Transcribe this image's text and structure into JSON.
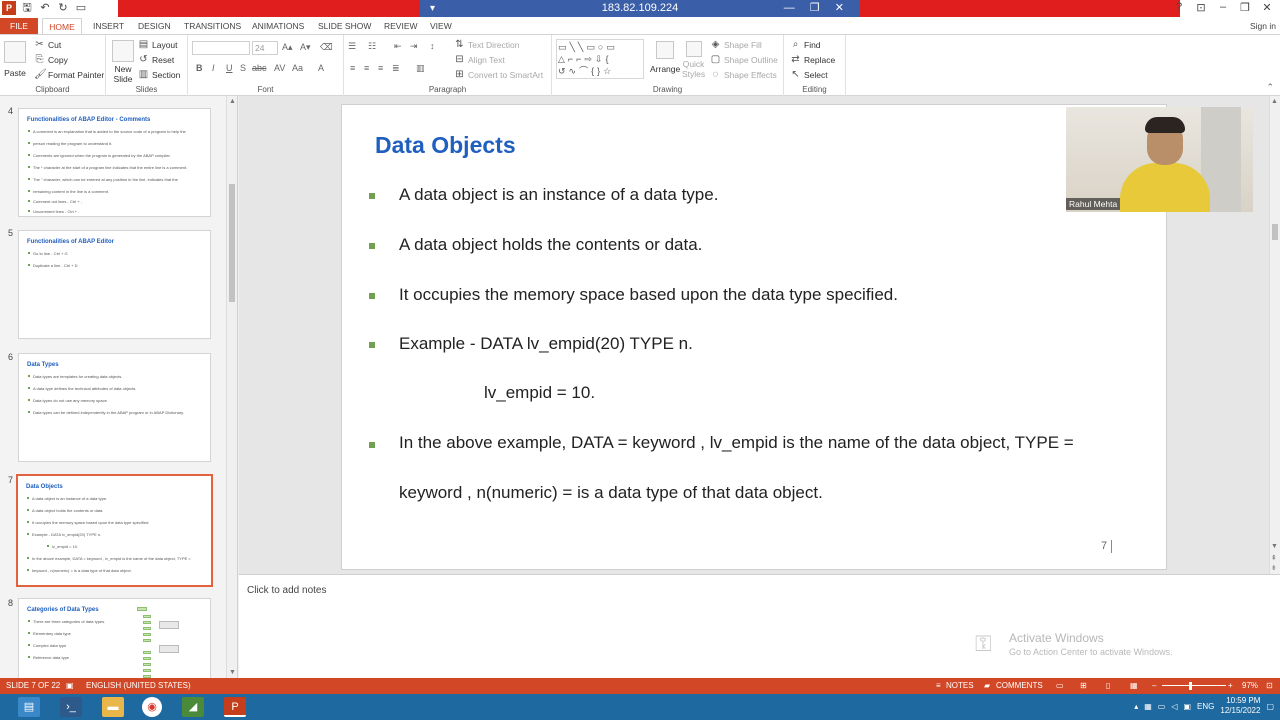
{
  "titlebar": {
    "remote_ip": "183.82.109.224",
    "remote_left": "▾",
    "remote_controls": "— ❐ ✕"
  },
  "ribbon_tabs": [
    "FILE",
    "HOME",
    "INSERT",
    "DESIGN",
    "TRANSITIONS",
    "ANIMATIONS",
    "SLIDE SHOW",
    "REVIEW",
    "VIEW"
  ],
  "signin": "Sign in",
  "ribbon": {
    "clipboard": {
      "paste": "Paste",
      "cut": "Cut",
      "copy": "Copy",
      "format_painter": "Format Painter",
      "label": "Clipboard"
    },
    "slides": {
      "new_slide": "New",
      "new_slide2": "Slide",
      "layout": "Layout",
      "reset": "Reset",
      "section": "Section",
      "label": "Slides"
    },
    "font": {
      "size": "24",
      "label": "Font"
    },
    "paragraph": {
      "text_direction": "Text Direction",
      "align_text": "Align Text",
      "convert": "Convert to SmartArt",
      "label": "Paragraph"
    },
    "drawing": {
      "arrange": "Arrange",
      "quick_styles": "Quick",
      "quick_styles2": "Styles",
      "shape_fill": "Shape Fill",
      "shape_outline": "Shape Outline",
      "shape_effects": "Shape Effects",
      "label": "Drawing"
    },
    "editing": {
      "find": "Find",
      "replace": "Replace",
      "select": "Select",
      "label": "Editing"
    }
  },
  "thumbnails": [
    {
      "num": "4",
      "title": "Functionalities of ABAP Editor - Comments",
      "lines": [
        "A comment is an explanation that is added to the source code of a program to help the",
        "person reading the program to understand it.",
        "Comments are ignored when the program is generated by the ABAP compiler.",
        "The * character at the start of a program line indicates that the entire line is a comment.",
        "The \" character, which can be entered at any position in the line, indicates that the",
        "remaining content in the line is a comment.",
        "Comment out lines -  Ctrl + ,",
        "Uncomment lines -  Ctrl + ."
      ]
    },
    {
      "num": "5",
      "title": "Functionalities of ABAP Editor",
      "lines": [
        "Go to line - Ctrl + G",
        "Duplicate a line - Ctrl + D"
      ]
    },
    {
      "num": "6",
      "title": "Data Types",
      "lines": [
        "Data types are templates for creating data objects.",
        "A data type defines the technical attributes of data objects.",
        "Data types do not use any memory space.",
        "Data types can be defined independently in the ABAP program or in ABAP Dictionary."
      ]
    },
    {
      "num": "7",
      "title": "Data Objects",
      "lines": [
        "A data object is an instance of a data type.",
        "A data object holds the contents or data.",
        "It occupies the memory space based upon the data type specified.",
        "Example - DATA lv_empid(20) TYPE n.",
        "lv_empid = 10.",
        "In the above example, DATA = keyword , lv_empid is the name of the data object, TYPE =",
        "keyword , n(numeric) =  is a data type of that data object."
      ]
    },
    {
      "num": "8",
      "title": "Categories of Data Types",
      "lines": [
        "There are three categories of data types.",
        "Elementary data type",
        "Complex data type",
        "Reference data type"
      ]
    }
  ],
  "slide": {
    "title": "Data Objects",
    "bullets": [
      "A data object is an instance of a data type.",
      "A data object holds the contents or data.",
      "It occupies the memory space based upon the data type specified.",
      "Example - DATA lv_empid(20) TYPE n."
    ],
    "sub_line": "lv_empid = 10.",
    "bullet_5a": "In the above example, DATA = keyword , lv_empid is the name of the data object, TYPE =",
    "bullet_5b": "keyword , n(numeric) =  is a data type of that data object.",
    "page_number": "7",
    "accent": "#1f5fbf",
    "bullet_color": "#70a050"
  },
  "video": {
    "name": "Rahul Mehta"
  },
  "notes": {
    "placeholder": "Click to add notes"
  },
  "activate": {
    "line1": "Activate Windows",
    "line2": "Go to Action Center to activate Windows."
  },
  "status": {
    "slide_of": "SLIDE 7 OF 22",
    "language": "ENGLISH (UNITED STATES)",
    "notes": "NOTES",
    "comments": "COMMENTS",
    "zoom": "97%"
  },
  "taskbar": {
    "lang": "ENG",
    "time": "10:59 PM",
    "date": "12/15/2022"
  }
}
